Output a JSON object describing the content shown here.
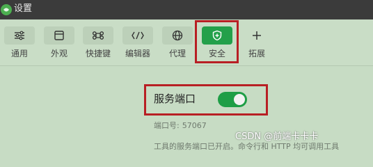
{
  "window": {
    "title": "设置"
  },
  "toolbar": {
    "items": [
      {
        "label": "通用",
        "icon": "sliders-icon"
      },
      {
        "label": "外观",
        "icon": "window-icon"
      },
      {
        "label": "快捷键",
        "icon": "command-key-icon"
      },
      {
        "label": "编辑器",
        "icon": "code-brackets-icon"
      },
      {
        "label": "代理",
        "icon": "globe-icon"
      },
      {
        "label": "安全",
        "icon": "shield-icon",
        "active": true
      },
      {
        "label": "拓展",
        "icon": "plus-icon"
      }
    ]
  },
  "security": {
    "service_port_label": "服务端口",
    "service_port_enabled": true,
    "port_label": "端口号:",
    "port_value": "57067",
    "description": "工具的服务端口已开启。命令行和 HTTP 均可调用工具"
  },
  "watermark": "CSDN @前端卡卡卡",
  "colors": {
    "accent": "#23a04a",
    "highlight_border": "#b81f24",
    "background": "#c7dcc4",
    "titlebar": "#3b3b3b"
  }
}
